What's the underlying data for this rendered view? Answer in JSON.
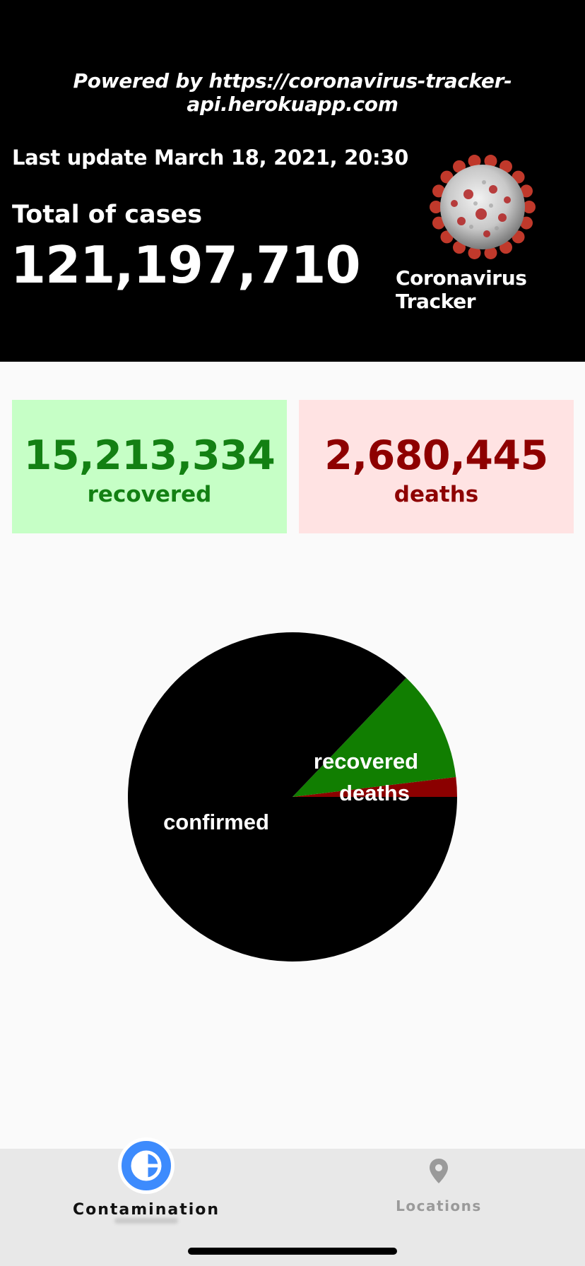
{
  "header": {
    "powered_by": "Powered by https://coronavirus-tracker-api.herokuapp.com",
    "last_update": "Last update March 18, 2021, 20:30",
    "total_label": "Total of cases",
    "total_value": "121,197,710",
    "app_title": "Coronavirus Tracker",
    "logo_icon": "coronavirus-icon"
  },
  "stats": {
    "recovered": {
      "value": "15,213,334",
      "label": "recovered",
      "color": "#138013",
      "background": "#c6ffc6"
    },
    "deaths": {
      "value": "2,680,445",
      "label": "deaths",
      "color": "#8e0000",
      "background": "#ffe3e3"
    }
  },
  "chart_data": {
    "type": "pie",
    "slices": [
      {
        "label": "confirmed",
        "value": 121197710,
        "color": "#000000"
      },
      {
        "label": "recovered",
        "value": 15213334,
        "color": "#117e01"
      },
      {
        "label": "deaths",
        "value": 2680445,
        "color": "#8b0000"
      }
    ]
  },
  "tabs": [
    {
      "label": "Contamination",
      "icon": "pie-chart-icon",
      "active": true,
      "accent": "#3d8bfd"
    },
    {
      "label": "Locations",
      "icon": "location-pin-icon",
      "active": false
    }
  ]
}
